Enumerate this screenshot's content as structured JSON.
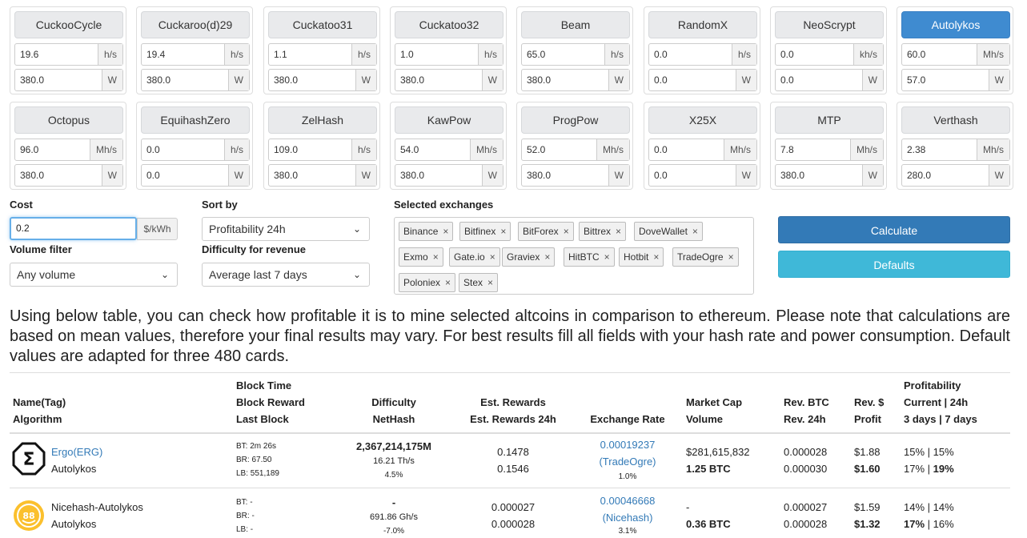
{
  "algorithms": [
    {
      "name": "CuckooCycle",
      "hashrate": "19.6",
      "hash_unit": "h/s",
      "power": "380.0",
      "power_unit": "W",
      "active": false
    },
    {
      "name": "Cuckaroo(d)29",
      "hashrate": "19.4",
      "hash_unit": "h/s",
      "power": "380.0",
      "power_unit": "W",
      "active": false
    },
    {
      "name": "Cuckatoo31",
      "hashrate": "1.1",
      "hash_unit": "h/s",
      "power": "380.0",
      "power_unit": "W",
      "active": false
    },
    {
      "name": "Cuckatoo32",
      "hashrate": "1.0",
      "hash_unit": "h/s",
      "power": "380.0",
      "power_unit": "W",
      "active": false
    },
    {
      "name": "Beam",
      "hashrate": "65.0",
      "hash_unit": "h/s",
      "power": "380.0",
      "power_unit": "W",
      "active": false
    },
    {
      "name": "RandomX",
      "hashrate": "0.0",
      "hash_unit": "h/s",
      "power": "0.0",
      "power_unit": "W",
      "active": false
    },
    {
      "name": "NeoScrypt",
      "hashrate": "0.0",
      "hash_unit": "kh/s",
      "power": "0.0",
      "power_unit": "W",
      "active": false
    },
    {
      "name": "Autolykos",
      "hashrate": "60.0",
      "hash_unit": "Mh/s",
      "power": "57.0",
      "power_unit": "W",
      "active": true
    },
    {
      "name": "Octopus",
      "hashrate": "96.0",
      "hash_unit": "Mh/s",
      "power": "380.0",
      "power_unit": "W",
      "active": false
    },
    {
      "name": "EquihashZero",
      "hashrate": "0.0",
      "hash_unit": "h/s",
      "power": "0.0",
      "power_unit": "W",
      "active": false
    },
    {
      "name": "ZelHash",
      "hashrate": "109.0",
      "hash_unit": "h/s",
      "power": "380.0",
      "power_unit": "W",
      "active": false
    },
    {
      "name": "KawPow",
      "hashrate": "54.0",
      "hash_unit": "Mh/s",
      "power": "380.0",
      "power_unit": "W",
      "active": false
    },
    {
      "name": "ProgPow",
      "hashrate": "52.0",
      "hash_unit": "Mh/s",
      "power": "380.0",
      "power_unit": "W",
      "active": false
    },
    {
      "name": "X25X",
      "hashrate": "0.0",
      "hash_unit": "Mh/s",
      "power": "0.0",
      "power_unit": "W",
      "active": false
    },
    {
      "name": "MTP",
      "hashrate": "7.8",
      "hash_unit": "Mh/s",
      "power": "380.0",
      "power_unit": "W",
      "active": false
    },
    {
      "name": "Verthash",
      "hashrate": "2.38",
      "hash_unit": "Mh/s",
      "power": "280.0",
      "power_unit": "W",
      "active": false
    }
  ],
  "controls": {
    "cost_label": "Cost",
    "cost_value": "0.2",
    "cost_unit": "$/kWh",
    "sort_label": "Sort by",
    "sort_value": "Profitability 24h",
    "volume_label": "Volume filter",
    "volume_value": "Any volume",
    "difficulty_label": "Difficulty for revenue",
    "difficulty_value": "Average last 7 days",
    "exchanges_label": "Selected exchanges",
    "exchanges": [
      "Binance",
      "Bitfinex",
      "BitForex",
      "Bittrex",
      "DoveWallet",
      "Exmo",
      "Gate.io",
      "Graviex",
      "HitBTC",
      "Hotbit",
      "TradeOgre",
      "Poloniex",
      "Stex"
    ],
    "remove_glyph": "×",
    "chevron_glyph": "⌄",
    "calculate_label": "Calculate",
    "defaults_label": "Defaults"
  },
  "intro_text": "Using below table, you can check how profitable it is to mine selected altcoins in comparison to ethereum. Please note that calculations are based on mean values, therefore your final results may vary. For best results fill all fields with your hash rate and power consumption. Default values are adapted for three 480 cards.",
  "table": {
    "headers": {
      "name": [
        "Name(Tag)",
        "Algorithm"
      ],
      "block": [
        "Block Time",
        "Block Reward",
        "Last Block"
      ],
      "difficulty": [
        "Difficulty",
        "NetHash"
      ],
      "rewards": [
        "Est. Rewards",
        "Est. Rewards 24h"
      ],
      "exchange": [
        "Exchange Rate"
      ],
      "market": [
        "Market Cap",
        "Volume"
      ],
      "revbtc": [
        "Rev. BTC",
        "Rev. 24h"
      ],
      "revusd": [
        "Rev. $",
        "Profit"
      ],
      "profit": [
        "Profitability",
        "Current | 24h",
        "3 days | 7 days"
      ]
    },
    "rows": [
      {
        "name": "Ergo(ERG)",
        "algorithm": "Autolykos",
        "icon": "ergo-logo-icon",
        "bt": "BT: 2m 26s",
        "br": "BR: 67.50",
        "lb": "LB: 551,189",
        "difficulty": "2,367,214,175M",
        "nethash": "16.21 Th/s",
        "diff_change": "4.5%",
        "est_rewards": "0.1478",
        "est_rewards_24h": "0.1546",
        "exchange_rate": "0.00019237",
        "exchange_name": "(TradeOgre)",
        "exchange_change": "1.0%",
        "market_cap": "$281,615,832",
        "volume": "1.25 BTC",
        "rev_btc": "0.000028",
        "rev_24h": "0.000030",
        "rev_usd": "$1.88",
        "profit": "$1.60",
        "prof_current": "15%",
        "prof_24h": "15%",
        "prof_3d": "17%",
        "prof_7d": "19%"
      },
      {
        "name": "Nicehash-Autolykos",
        "algorithm": "Autolykos",
        "icon": "nicehash-logo-icon",
        "bt": "BT: -",
        "br": "BR: -",
        "lb": "LB: -",
        "difficulty": "-",
        "nethash": "691.86 Gh/s",
        "diff_change": "-7.0%",
        "est_rewards": "0.000027",
        "est_rewards_24h": "0.000028",
        "exchange_rate": "0.00046668",
        "exchange_name": "(Nicehash)",
        "exchange_change": "3.1%",
        "market_cap": "-",
        "volume": "0.36 BTC",
        "rev_btc": "0.000027",
        "rev_24h": "0.000028",
        "rev_usd": "$1.59",
        "profit": "$1.32",
        "prof_current": "14%",
        "prof_24h": "14%",
        "prof_3d": "17%",
        "prof_7d": "16%"
      }
    ]
  }
}
